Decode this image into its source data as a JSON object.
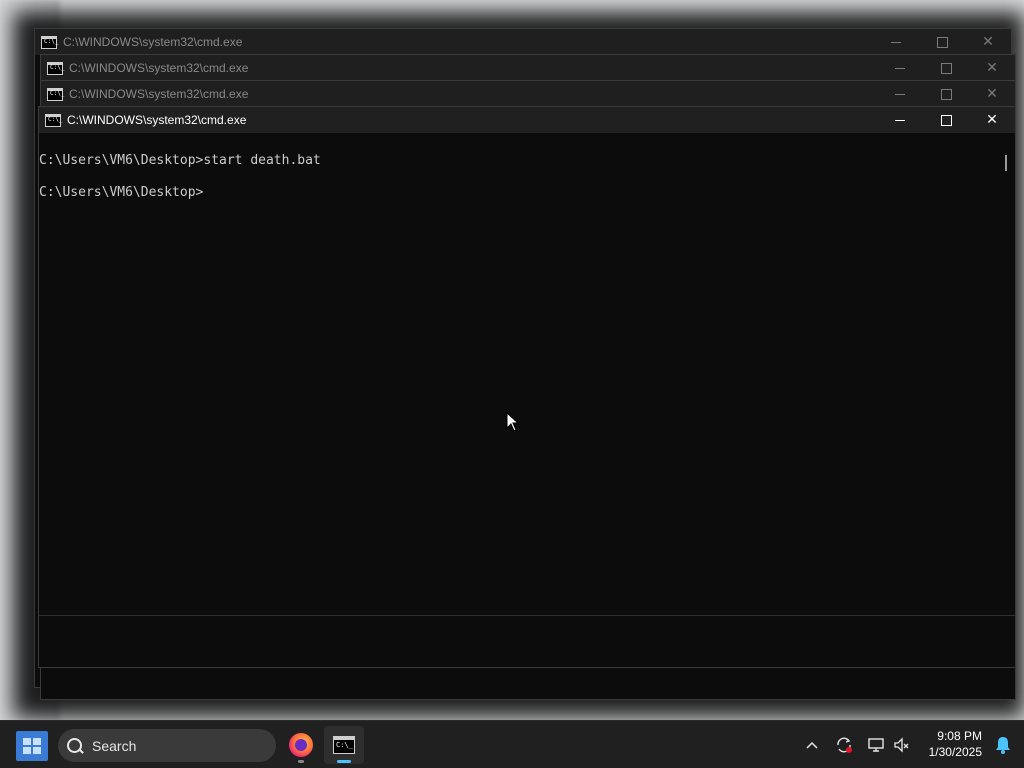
{
  "windows": [
    {
      "title": "C:\\WINDOWS\\system32\\cmd.exe"
    },
    {
      "title": "C:\\WINDOWS\\system32\\cmd.exe"
    },
    {
      "title": "C:\\WINDOWS\\system32\\cmd.exe"
    },
    {
      "title": "C:\\WINDOWS\\system32\\cmd.exe"
    }
  ],
  "console": {
    "lines": [
      "C:\\Users\\VM6\\Desktop>start death.bat",
      "C:\\Users\\VM6\\Desktop>"
    ]
  },
  "window_controls": {
    "close_glyph": "✕"
  },
  "taskbar": {
    "search_label": "Search",
    "apps": [
      {
        "name": "firefox",
        "icon": "firefox-icon"
      },
      {
        "name": "cmd",
        "icon": "cmd-icon",
        "icon_text": "C:\\_"
      }
    ],
    "tray": {
      "chevron": "^",
      "time": "9:08 PM",
      "date": "1/30/2025"
    }
  },
  "colors": {
    "console_bg": "#0c0c0c",
    "console_text": "#cccccc",
    "taskbar_bg": "#202020",
    "start_blue": "#3a7bd5",
    "notification_blue": "#4cc2ff"
  }
}
